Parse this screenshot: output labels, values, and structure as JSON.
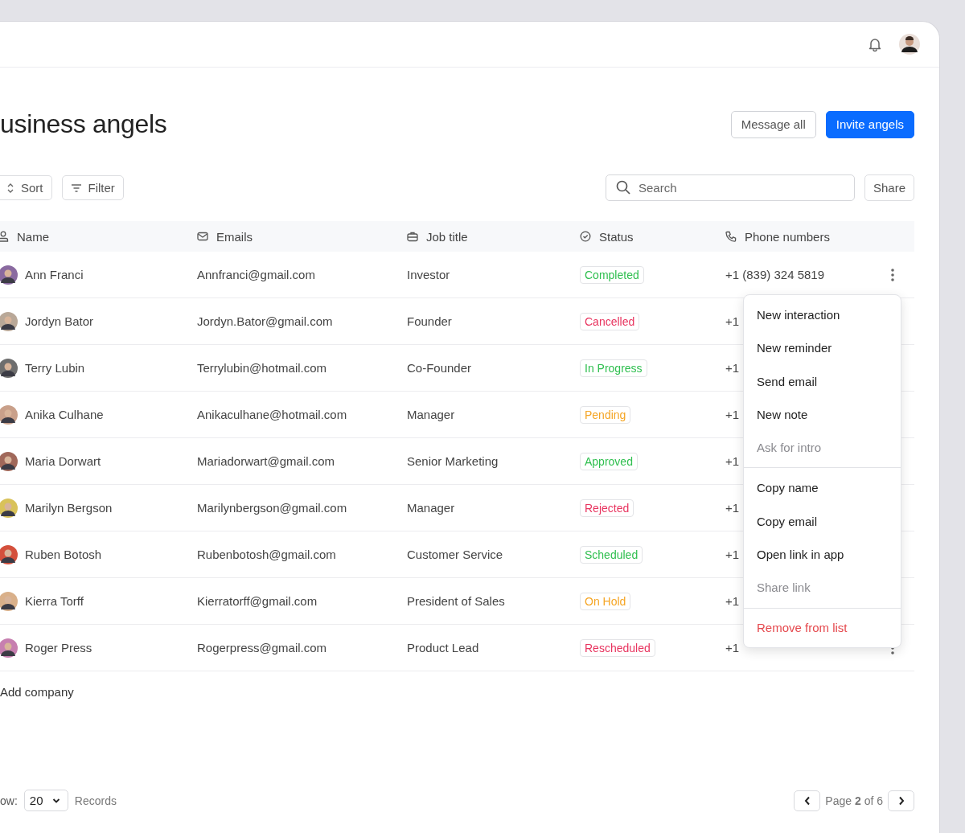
{
  "title": "usiness angels",
  "actions": [
    {
      "label": "Message all",
      "kind": "secondary"
    },
    {
      "label": "Invite angels",
      "kind": "primary"
    }
  ],
  "toolbar": {
    "sort": "Sort",
    "filter": "Filter",
    "search": {
      "placeholder": "Search"
    },
    "share": "Share"
  },
  "table": {
    "columns": [
      {
        "label": "Name"
      },
      {
        "label": "Emails"
      },
      {
        "label": "Job title"
      },
      {
        "label": "Status"
      },
      {
        "label": "Phone numbers"
      }
    ],
    "rows": [
      {
        "name": "Ann Franci",
        "email": "Annfranci@gmail.com",
        "job": "Investor",
        "status": {
          "label": "Completed",
          "color": "#2fbf4f"
        },
        "phone": "+1 (839) 324 5819",
        "menu_button": true
      },
      {
        "name": "Jordyn Bator",
        "email": "Jordyn.Bator@gmail.com",
        "job": "Founder",
        "status": {
          "label": "Cancelled",
          "color": "#e8345f"
        },
        "phone": "+1"
      },
      {
        "name": "Terry Lubin",
        "email": "Terrylubin@hotmail.com",
        "job": "Co-Founder",
        "status": {
          "label": "In Progress",
          "color": "#2fbf4f"
        },
        "phone": "+1"
      },
      {
        "name": "Anika Culhane",
        "email": "Anikaculhane@hotmail.com",
        "job": "Manager",
        "status": {
          "label": "Pending",
          "color": "#f5a524"
        },
        "phone": "+1"
      },
      {
        "name": "Maria Dorwart",
        "email": "Mariadorwart@gmail.com",
        "job": "Senior Marketing",
        "status": {
          "label": "Approved",
          "color": "#2fbf4f"
        },
        "phone": "+1"
      },
      {
        "name": "Marilyn Bergson",
        "email": "Marilynbergson@gmail.com",
        "job": "Manager",
        "status": {
          "label": "Rejected",
          "color": "#e8345f"
        },
        "phone": "+1"
      },
      {
        "name": "Ruben Botosh",
        "email": "Rubenbotosh@gmail.com",
        "job": "Customer Service",
        "status": {
          "label": "Scheduled",
          "color": "#2fbf4f"
        },
        "phone": "+1"
      },
      {
        "name": "Kierra Torff",
        "email": "Kierratorff@gmail.com",
        "job": "President of Sales",
        "status": {
          "label": "On Hold",
          "color": "#f5a524"
        },
        "phone": "+1"
      },
      {
        "name": "Roger Press",
        "email": "Rogerpress@gmail.com",
        "job": "Product Lead",
        "status": {
          "label": "Rescheduled",
          "color": "#e8345f"
        },
        "phone": "+1",
        "menu_button": true
      }
    ]
  },
  "context_menu": {
    "groups": [
      [
        {
          "label": "New interaction",
          "kind": "normal"
        },
        {
          "label": "New reminder",
          "kind": "normal"
        },
        {
          "label": "Send email",
          "kind": "normal"
        },
        {
          "label": "New note",
          "kind": "normal"
        },
        {
          "label": "Ask for intro",
          "kind": "disabled"
        }
      ],
      [
        {
          "label": "Copy name",
          "kind": "normal"
        },
        {
          "label": "Copy email",
          "kind": "normal"
        },
        {
          "label": "Open link in app",
          "kind": "normal"
        },
        {
          "label": "Share link",
          "kind": "disabled"
        }
      ],
      [
        {
          "label": "Remove from list",
          "kind": "danger"
        }
      ]
    ]
  },
  "add_link": "Add company",
  "footer": {
    "show_label": "ow:",
    "page_size": "20",
    "records": "Records",
    "page_text": "Page **2** of 6"
  }
}
